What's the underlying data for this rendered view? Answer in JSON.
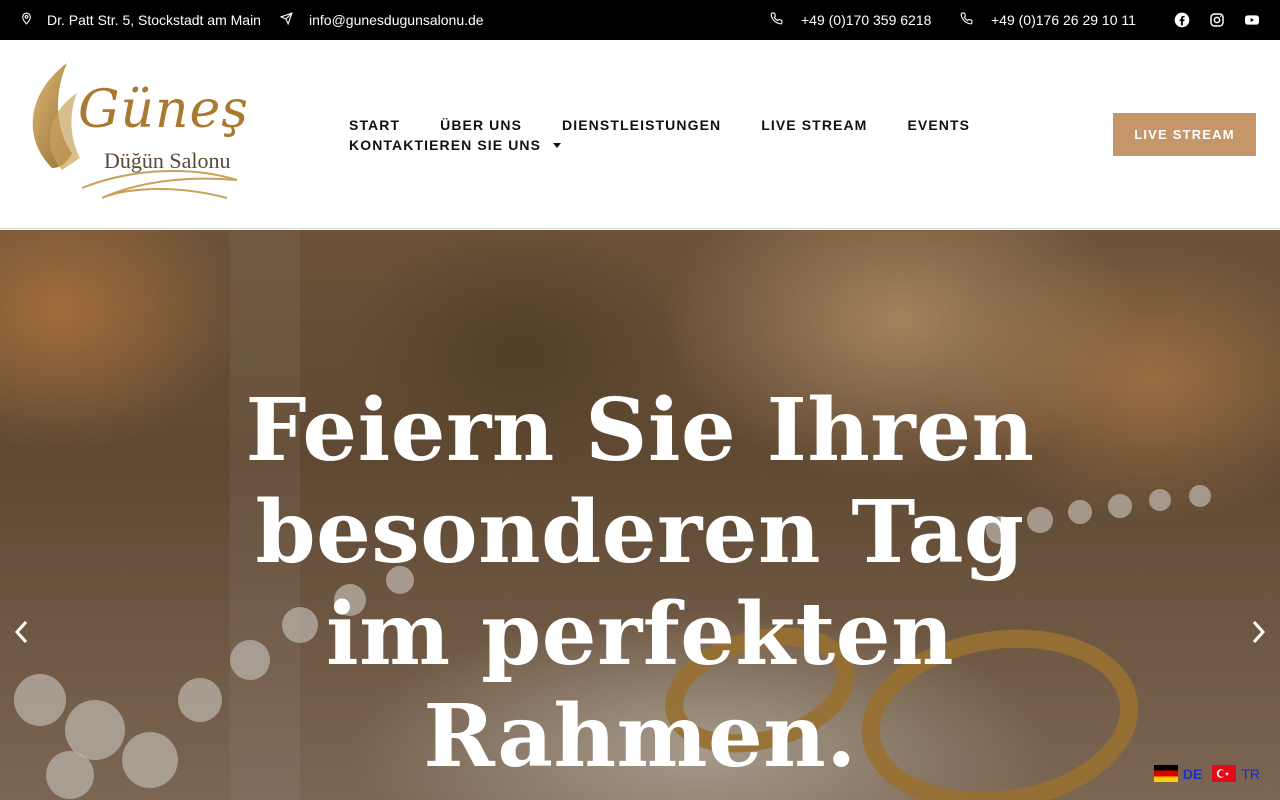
{
  "topbar": {
    "address": "Dr. Patt Str. 5, Stockstadt am Main",
    "email": "info@gunesdugunsalonu.de",
    "phone1": "+49 (0)170 359 6218",
    "phone2": "+49 (0)176 26 29 10 11",
    "social": [
      "facebook-icon",
      "instagram-icon",
      "youtube-icon"
    ]
  },
  "logo": {
    "main": "Güneş",
    "sub": "Düğün Salonu",
    "color": "#a8792f"
  },
  "nav": {
    "items": [
      "START",
      "ÜBER UNS",
      "DIENSTLEISTUNGEN",
      "LIVE STREAM",
      "EVENTS"
    ],
    "dropdown_item": "KONTAKTIEREN SIE UNS"
  },
  "cta": {
    "label": "LIVE STREAM",
    "color": "#c5966a"
  },
  "hero": {
    "title_lines": [
      "Feiern Sie Ihren",
      "besonderen Tag",
      "im perfekten",
      "Rahmen."
    ]
  },
  "language": {
    "options": [
      {
        "code": "DE",
        "flag": "germany-flag-icon"
      },
      {
        "code": "TR",
        "flag": "turkey-flag-icon"
      }
    ]
  }
}
